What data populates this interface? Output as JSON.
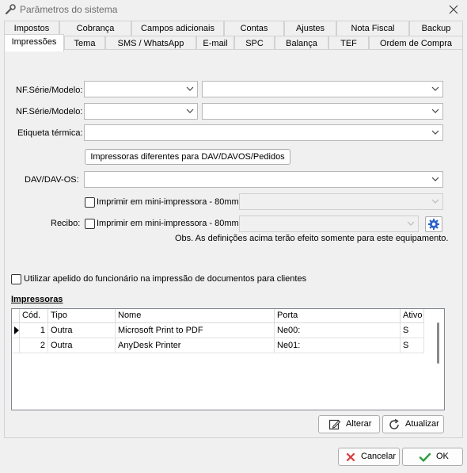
{
  "window": {
    "title": "Parâmetros do sistema"
  },
  "tabs_row1": [
    "Impostos",
    "Cobrança",
    "Campos adicionais",
    "Contas",
    "Ajustes",
    "Nota Fiscal",
    "Backup"
  ],
  "tabs_row2": [
    "Impressões",
    "Tema",
    "SMS / WhatsApp",
    "E-mail",
    "SPC",
    "Balança",
    "TEF",
    "Ordem de Compra"
  ],
  "form": {
    "nf_serie_label_1": "NF.Série/Modelo:",
    "nf_serie_label_2": "NF.Série/Modelo:",
    "etiqueta_label": "Etiqueta térmica:",
    "impressoras_dif_button": "Impressoras diferentes para DAV/DAVOS/Pedidos",
    "dav_label": "DAV/DAV-OS:",
    "mini_impressora_1": "Imprimir em mini-impressora - 80mm",
    "recibo_label": "Recibo:",
    "mini_impressora_2": "Imprimir em mini-impressora - 80mm",
    "obs_text": "Obs. As definições acima terão efeito somente para este equipamento.",
    "apelido_checkbox": "Utilizar apelido do funcionário na impressão de documentos para clientes",
    "impressoras_section": "Impressoras"
  },
  "printers": {
    "columns": [
      "Cód.",
      "Tipo",
      "Nome",
      "Porta",
      "Ativo"
    ],
    "rows": [
      {
        "cod": "1",
        "tipo": "Outra",
        "nome": "Microsoft Print to PDF",
        "porta": "Ne00:",
        "ativo": "S"
      },
      {
        "cod": "2",
        "tipo": "Outra",
        "nome": "AnyDesk Printer",
        "porta": "Ne01:",
        "ativo": "S"
      }
    ]
  },
  "buttons": {
    "alterar": "Alterar",
    "atualizar": "Atualizar",
    "cancelar": "Cancelar",
    "ok": "OK"
  },
  "colors": {
    "accent": "#0078d7",
    "cancel_icon": "#d83b3b",
    "ok_icon": "#2e9e3e"
  }
}
